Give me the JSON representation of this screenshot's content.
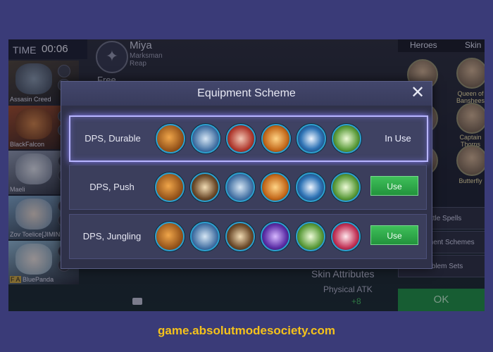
{
  "game": {
    "time_label": "TIME",
    "time_value": "00:06",
    "players": [
      {
        "name": "Assasin Creed"
      },
      {
        "name": "BlackFalcon"
      },
      {
        "name": "Maeli"
      },
      {
        "name": "Zov Toelice[JIMIN"
      },
      {
        "name": "BluePanda",
        "prefix": "F A"
      }
    ],
    "hero": {
      "name": "Miya",
      "role": "Marksman",
      "specialty": "Reap",
      "status": "Free"
    },
    "right_tabs": [
      "Heroes",
      "Skin"
    ],
    "right_heroes": [
      "Queen of Banshees",
      "Captain Thorns",
      "Butterfly"
    ],
    "side_buttons": [
      "Battle Spells",
      "Equipment Schemes",
      "Emblem Sets"
    ],
    "ok_label": "OK",
    "skin_attributes": {
      "title": "Skin Attributes",
      "stat": "Physical ATK",
      "value": "+8"
    }
  },
  "modal": {
    "title": "Equipment Scheme",
    "close_symbol": "✕",
    "schemes": [
      {
        "name": "DPS, Durable",
        "status": "In Use",
        "selected": true,
        "items": [
          "boots-icon",
          "blade-icon",
          "claw-icon",
          "bow-icon",
          "crescent-blade-icon",
          "spear-icon"
        ]
      },
      {
        "name": "DPS, Push",
        "button": "Use",
        "selected": false,
        "items": [
          "boots-icon",
          "axe-icon",
          "blade-icon",
          "bow-icon",
          "crescent-blade-icon",
          "spear-icon"
        ]
      },
      {
        "name": "DPS, Jungling",
        "button": "Use",
        "selected": false,
        "items": [
          "boots-icon",
          "blade-icon",
          "axe-icon",
          "purple-blade-icon",
          "spear-icon",
          "red-sword-icon"
        ]
      }
    ]
  },
  "watermark": "game.absolutmodesociety.com"
}
